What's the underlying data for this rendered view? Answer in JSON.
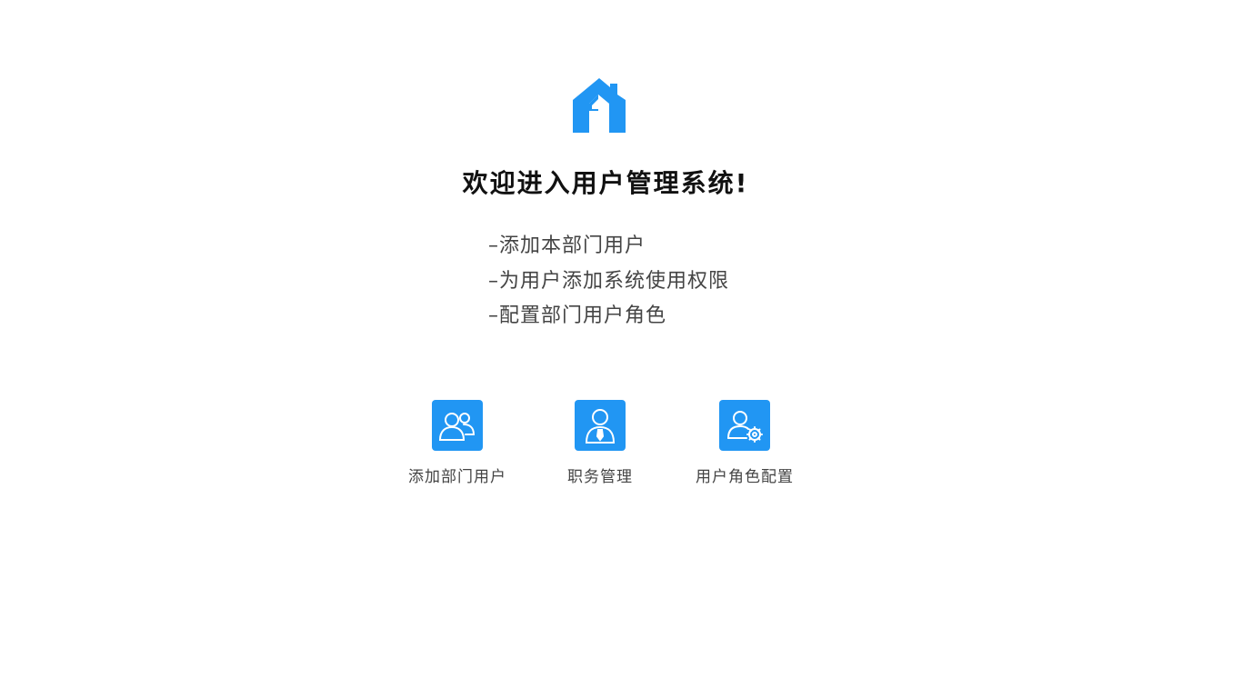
{
  "brand": {
    "logo_icon": "house-a-logo-icon",
    "accent_color": "#2196f3"
  },
  "welcome": {
    "title": "欢迎进入用户管理系统!"
  },
  "features": [
    "–添加本部门用户",
    "–为用户添加系统使用权限",
    "–配置部门用户角色"
  ],
  "tiles": [
    {
      "label": "添加部门用户",
      "icon": "users-icon"
    },
    {
      "label": "职务管理",
      "icon": "person-tie-icon"
    },
    {
      "label": "用户角色配置",
      "icon": "user-settings-icon"
    }
  ]
}
